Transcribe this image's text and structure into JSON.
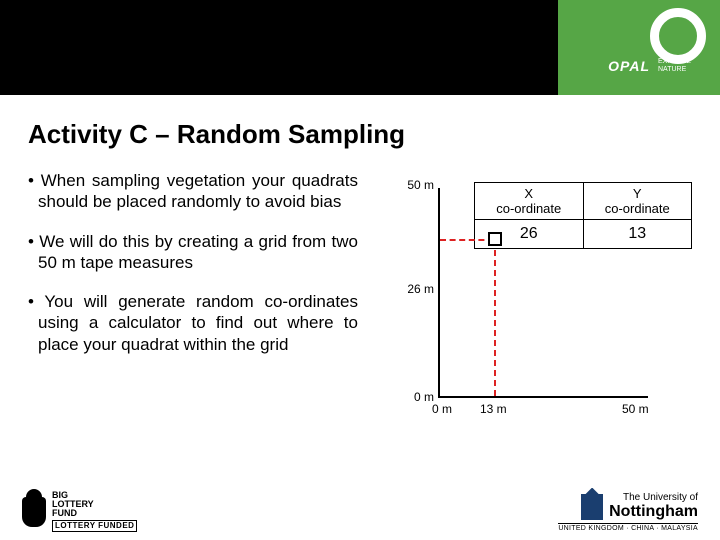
{
  "brand": {
    "name": "OPAL",
    "tag1": "EXPLORE",
    "tag2": "NATURE"
  },
  "title": "Activity C – Random Sampling",
  "bullets": {
    "b1": "• When sampling vegetation your quadrats should be placed randomly to avoid bias",
    "b2": "• We will do this by creating a grid from two 50 m tape measures",
    "b3": "• You will generate random co-ordinates using a calculator to find out where to place your quadrat within the grid"
  },
  "table": {
    "xhead1": "X",
    "xhead2": "co-ordinate",
    "yhead1": "Y",
    "yhead2": "co-ordinate",
    "xval": "26",
    "yval": "13"
  },
  "chart_data": {
    "type": "scatter",
    "title": "",
    "xlabel": "",
    "ylabel": "",
    "xlim": [
      0,
      50
    ],
    "ylim": [
      0,
      50
    ],
    "x": [
      13
    ],
    "y": [
      26
    ],
    "x_ticks": [
      {
        "v": 0,
        "l": "0 m"
      },
      {
        "v": 13,
        "l": "13 m"
      },
      {
        "v": 50,
        "l": "50 m"
      }
    ],
    "y_ticks": [
      {
        "v": 0,
        "l": "0 m"
      },
      {
        "v": 26,
        "l": "26 m"
      },
      {
        "v": 50,
        "l": "50 m"
      }
    ]
  },
  "footer": {
    "lottery1": "BIG",
    "lottery2": "LOTTERY",
    "lottery3": "FUND",
    "lottery_sub": "LOTTERY FUNDED",
    "uni_pre": "The University of",
    "uni_name": "Nottingham",
    "uni_campus": "UNITED KINGDOM · CHINA · MALAYSIA"
  }
}
